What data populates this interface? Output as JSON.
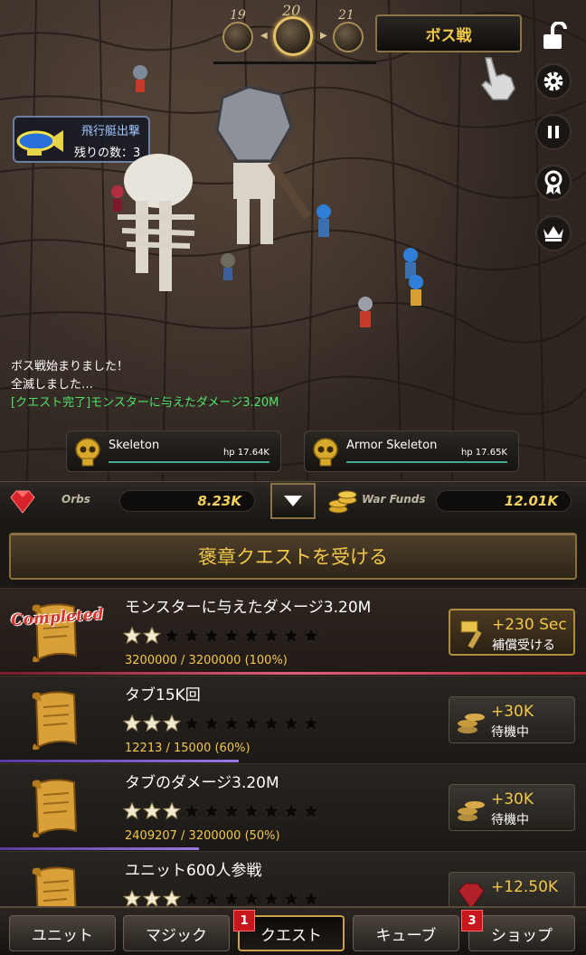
{
  "stage": {
    "prev": "19",
    "current": "20",
    "next": "21"
  },
  "boss_button": "ボス戦",
  "airship": {
    "title": "飛行艇出撃",
    "remaining": "残りの数：3"
  },
  "battle_log": [
    {
      "text": "ボス戦始まりました！",
      "color": "#ffffff"
    },
    {
      "text": "全滅しました…",
      "color": "#ffffff"
    },
    {
      "text": "[クエスト完了]モンスターに与えたダメージ3.20M",
      "color": "#4fe36a"
    }
  ],
  "enemies": [
    {
      "name": "Skeleton",
      "hp": "hp 17.64K"
    },
    {
      "name": "Armor Skeleton",
      "hp": "hp 17.65K"
    }
  ],
  "resources": {
    "orbs_label": "Orbs",
    "orbs_value": "8.23K",
    "funds_label": "War Funds",
    "funds_value": "12.01K"
  },
  "accept_quest_label": "褒章クエストを受ける",
  "quests": [
    {
      "title": "モンスターに与えたダメージ3.20M",
      "stars_filled": 2,
      "stars_total": 10,
      "progress": "3200000 / 3200000 (100%)",
      "progress_fraction": 1.0,
      "completed_stamp": "Completed",
      "reward": "+230 Sec",
      "status": "補償受ける",
      "reward_type": "hammer"
    },
    {
      "title": "タブ15K回",
      "stars_filled": 3,
      "stars_total": 10,
      "progress": "12213 / 15000 (60%)",
      "progress_fraction": 0.6,
      "completed_stamp": "",
      "reward": "+30K",
      "status": "待機中",
      "reward_type": "coins"
    },
    {
      "title": "タブのダメージ3.20M",
      "stars_filled": 3,
      "stars_total": 10,
      "progress": "2409207 / 3200000 (50%)",
      "progress_fraction": 0.5,
      "completed_stamp": "",
      "reward": "+30K",
      "status": "待機中",
      "reward_type": "coins"
    },
    {
      "title": "ユニット600人参戦",
      "stars_filled": 3,
      "stars_total": 10,
      "progress": "",
      "progress_fraction": 0,
      "completed_stamp": "",
      "reward": "+12.50K",
      "status": "",
      "reward_type": "gem"
    }
  ],
  "tabs": [
    {
      "label": "ユニット",
      "badge": ""
    },
    {
      "label": "マジック",
      "badge": ""
    },
    {
      "label": "クエスト",
      "badge": "1"
    },
    {
      "label": "キューブ",
      "badge": ""
    },
    {
      "label": "ショップ",
      "badge": "3"
    }
  ],
  "colors": {
    "gold": "#f2c84a",
    "green_log": "#4fe36a",
    "badge_red": "#c8161d",
    "completed_red": "#d8322b"
  }
}
